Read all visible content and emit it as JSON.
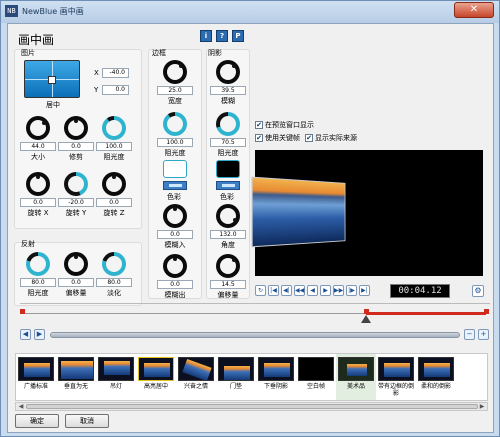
{
  "window": {
    "app_icon_text": "NB",
    "title": "NewBlue 画中画",
    "close_glyph": "✕"
  },
  "heading": "画中画",
  "sections": {
    "picture": "图片",
    "border": "边框",
    "shadow": "阴影",
    "reflection": "反射"
  },
  "picture": {
    "position_label": "居中",
    "x_label": "X",
    "x_value": "-40.0",
    "y_label": "Y",
    "y_value": "0.0",
    "knobs": [
      {
        "label": "大小",
        "value": "44.0"
      },
      {
        "label": "修剪",
        "value": "0.0"
      },
      {
        "label": "阻光度",
        "value": "100.0"
      },
      {
        "label": "旋转 X",
        "value": "0.0"
      },
      {
        "label": "旋转 Y",
        "value": "-20.0"
      },
      {
        "label": "旋转 Z",
        "value": "0.0"
      }
    ]
  },
  "reflection": {
    "knobs": [
      {
        "label": "阻光度",
        "value": "80.0"
      },
      {
        "label": "偏移量",
        "value": "0.0"
      },
      {
        "label": "淡化",
        "value": "80.0"
      }
    ]
  },
  "border": {
    "knobs": [
      {
        "label": "宽度",
        "value": "25.0"
      },
      {
        "label": "阻光度",
        "value": "100.0"
      },
      {
        "label": "模糊入",
        "value": "0.0"
      },
      {
        "label": "模糊出",
        "value": "0.0"
      }
    ],
    "color_label": "色彩",
    "swatch_color": "#ffffff"
  },
  "shadow": {
    "knobs": [
      {
        "label": "模糊",
        "value": "39.5"
      },
      {
        "label": "阻光度",
        "value": "70.5"
      },
      {
        "label": "角度",
        "value": "132.0"
      },
      {
        "label": "偏移量",
        "value": "14.5"
      }
    ],
    "color_label": "色彩",
    "swatch_color": "#000000"
  },
  "help_buttons": [
    "i",
    "?",
    "P"
  ],
  "options": {
    "show_in_preview": "在预览窗口显示",
    "use_keyframes": "使用关键帧",
    "show_actual_source": "显示实际来源"
  },
  "transport": {
    "buttons": [
      "↻",
      "|◀",
      "◀|",
      "◀◀",
      "◀",
      "▶",
      "▶▶",
      "|▶",
      "▶|"
    ],
    "timecode": "00:04.12",
    "settings_glyph": "⚙"
  },
  "timeline_nav": {
    "prev": "◀",
    "next": "▶",
    "minus": "−",
    "plus": "+"
  },
  "presets": [
    {
      "name": "广播标准"
    },
    {
      "name": "垂直为无"
    },
    {
      "name": "吊灯"
    },
    {
      "name": "高亮居中"
    },
    {
      "name": "兴奋之情"
    },
    {
      "name": "门垫"
    },
    {
      "name": "下垂阴影"
    },
    {
      "name": "空白帧"
    },
    {
      "name": "美术品"
    },
    {
      "name": "带有边框的倒影"
    },
    {
      "name": "柔和的倒影"
    }
  ],
  "footer": {
    "ok": "确定",
    "cancel": "取消"
  },
  "accent_color": "#2fb4d0"
}
